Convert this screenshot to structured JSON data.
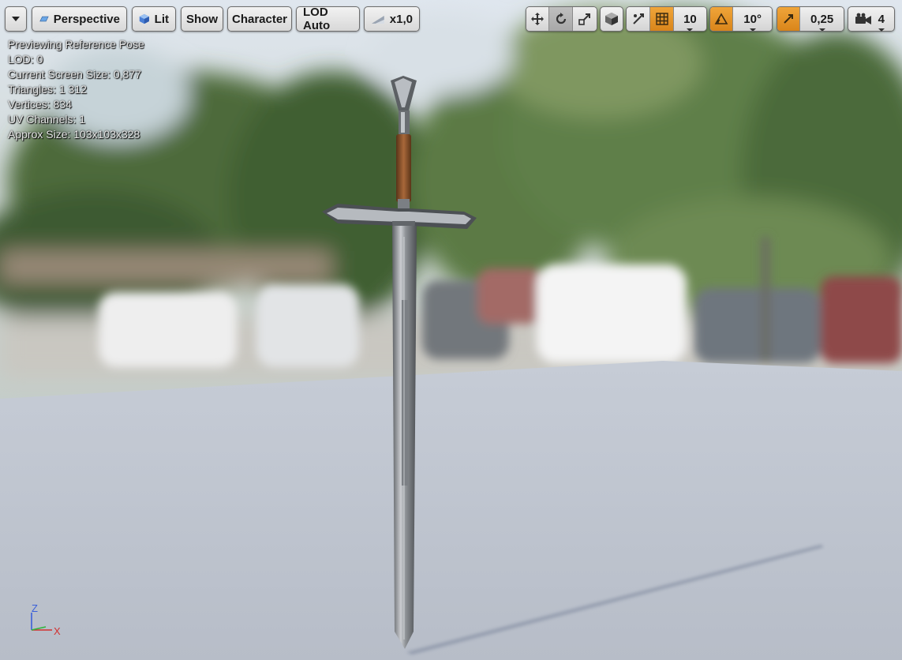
{
  "toolbar": {
    "perspective": "Perspective",
    "lit": "Lit",
    "show": "Show",
    "character": "Character",
    "lod": "LOD Auto",
    "speed": "x1,0",
    "grid_snap_value": "10",
    "rotation_snap_value": "10°",
    "scale_snap_value": "0,25",
    "camera_speed_value": "4"
  },
  "stats": {
    "pose": "Previewing Reference Pose",
    "lod": "LOD: 0",
    "screen_size": "Current Screen Size: 0,877",
    "triangles": "Triangles: 1 312",
    "vertices": "Vertices: 834",
    "uv": "UV Channels: 1",
    "approx": "Approx Size: 103x103x328"
  },
  "axis": {
    "z": "Z",
    "x": "X"
  },
  "colors": {
    "accent_orange": "#e8941f",
    "axis_x": "#d13030",
    "axis_y": "#2fb53a",
    "axis_z": "#3a5fd9"
  },
  "icons": [
    "dropdown-icon",
    "perspective-icon",
    "lit-cube-icon",
    "speed-icon",
    "translate-icon",
    "rotate-icon",
    "scale-icon",
    "local-space-icon",
    "surface-snap-icon",
    "grid-icon",
    "rotation-snap-icon",
    "scale-snap-icon",
    "camera-icon"
  ]
}
